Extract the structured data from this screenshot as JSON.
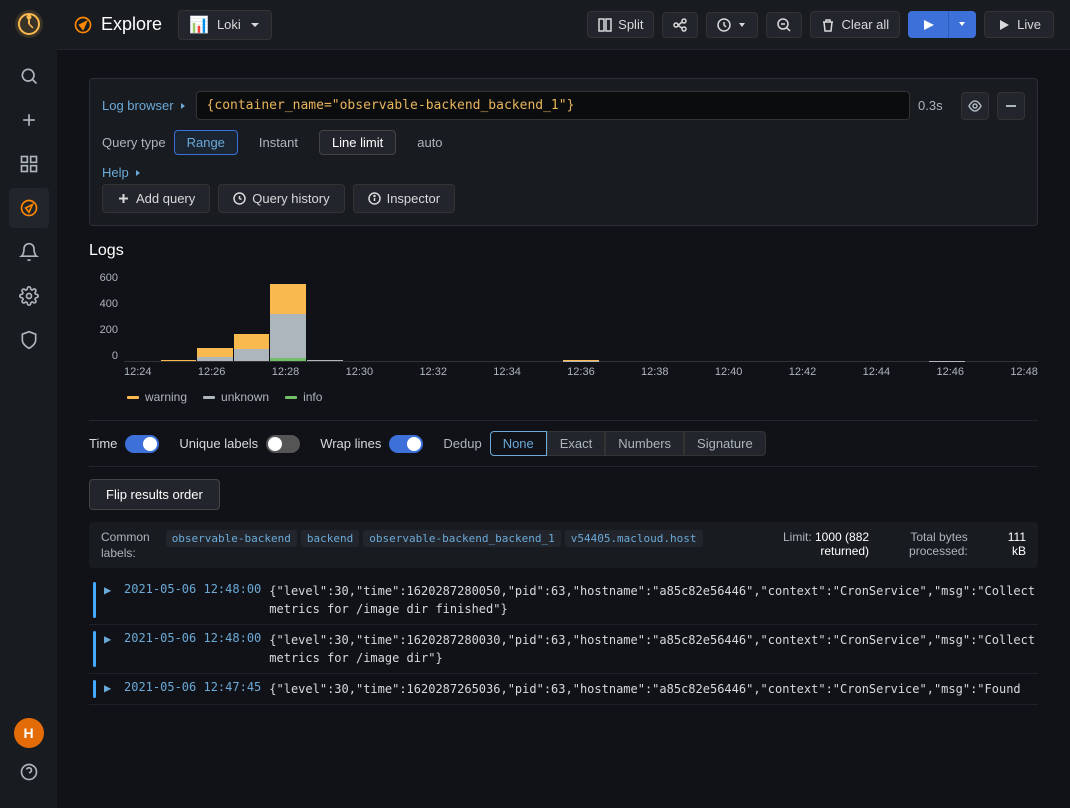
{
  "sidebar": {
    "logo_text": "G",
    "items": [
      {
        "id": "explore",
        "icon": "compass",
        "label": "Explore",
        "active": true
      },
      {
        "id": "search",
        "icon": "search",
        "label": "Search"
      },
      {
        "id": "add",
        "icon": "plus",
        "label": "Add"
      },
      {
        "id": "dashboards",
        "icon": "grid",
        "label": "Dashboards"
      },
      {
        "id": "explore-nav",
        "icon": "compass2",
        "label": "Explore"
      },
      {
        "id": "alerts",
        "icon": "bell",
        "label": "Alerts"
      },
      {
        "id": "settings",
        "icon": "gear",
        "label": "Settings"
      },
      {
        "id": "shield",
        "icon": "shield",
        "label": "Shield"
      }
    ],
    "bottom": [
      {
        "id": "avatar",
        "label": "H"
      },
      {
        "id": "help",
        "icon": "question",
        "label": "Help"
      }
    ]
  },
  "toolbar": {
    "explore_label": "Explore",
    "datasource_name": "Loki",
    "split_label": "Split",
    "clear_all_label": "Clear all",
    "live_label": "Live",
    "run_label": "Run"
  },
  "query": {
    "log_browser_label": "Log browser",
    "query_value": "{container_name=\"observable-backend_backend_1\"}",
    "query_time": "0.3s",
    "query_type_label": "Query type",
    "type_range": "Range",
    "type_instant": "Instant",
    "type_line_limit": "Line limit",
    "type_auto": "auto",
    "help_label": "Help"
  },
  "query_actions": {
    "add_query_label": "Add query",
    "query_history_label": "Query history",
    "inspector_label": "Inspector"
  },
  "logs": {
    "title": "Logs",
    "chart": {
      "y_labels": [
        "600",
        "400",
        "200",
        "0"
      ],
      "x_labels": [
        "12:24",
        "12:26",
        "12:28",
        "12:30",
        "12:32",
        "12:34",
        "12:36",
        "12:38",
        "12:40",
        "12:42",
        "12:44",
        "12:46",
        "12:48"
      ],
      "bars": [
        {
          "label": "12:24",
          "warning": 0,
          "unknown": 0,
          "info": 0
        },
        {
          "label": "12:25",
          "warning": 5,
          "unknown": 5,
          "info": 0
        },
        {
          "label": "12:26",
          "warning": 60,
          "unknown": 30,
          "info": 5
        },
        {
          "label": "12:27",
          "warning": 100,
          "unknown": 80,
          "info": 10
        },
        {
          "label": "12:28",
          "warning": 200,
          "unknown": 300,
          "info": 20
        },
        {
          "label": "12:29",
          "warning": 0,
          "unknown": 5,
          "info": 0
        },
        {
          "label": "12:30",
          "warning": 0,
          "unknown": 0,
          "info": 2
        },
        {
          "label": "12:31",
          "warning": 0,
          "unknown": 0,
          "info": 0
        },
        {
          "label": "12:32",
          "warning": 0,
          "unknown": 0,
          "info": 0
        },
        {
          "label": "12:33",
          "warning": 0,
          "unknown": 0,
          "info": 0
        },
        {
          "label": "12:34",
          "warning": 0,
          "unknown": 0,
          "info": 0
        },
        {
          "label": "12:35",
          "warning": 0,
          "unknown": 0,
          "info": 0
        },
        {
          "label": "12:36",
          "warning": 3,
          "unknown": 2,
          "info": 0
        },
        {
          "label": "12:37",
          "warning": 0,
          "unknown": 0,
          "info": 0
        },
        {
          "label": "12:38",
          "warning": 0,
          "unknown": 0,
          "info": 0
        },
        {
          "label": "12:39",
          "warning": 0,
          "unknown": 0,
          "info": 0
        },
        {
          "label": "12:40",
          "warning": 0,
          "unknown": 0,
          "info": 0
        },
        {
          "label": "12:41",
          "warning": 0,
          "unknown": 0,
          "info": 0
        },
        {
          "label": "12:42",
          "warning": 0,
          "unknown": 0,
          "info": 0
        },
        {
          "label": "12:43",
          "warning": 0,
          "unknown": 0,
          "info": 0
        },
        {
          "label": "12:44",
          "warning": 0,
          "unknown": 0,
          "info": 0
        },
        {
          "label": "12:45",
          "warning": 0,
          "unknown": 0,
          "info": 0
        },
        {
          "label": "12:46",
          "warning": 0,
          "unknown": 2,
          "info": 0
        },
        {
          "label": "12:47",
          "warning": 0,
          "unknown": 0,
          "info": 0
        },
        {
          "label": "12:48",
          "warning": 0,
          "unknown": 0,
          "info": 0
        }
      ],
      "max": 600,
      "legend": [
        {
          "label": "warning",
          "color": "#f9b94e"
        },
        {
          "label": "unknown",
          "color": "#adb5bd"
        },
        {
          "label": "info",
          "color": "#73bf69"
        }
      ]
    },
    "controls": {
      "time_label": "Time",
      "time_on": true,
      "unique_labels_label": "Unique labels",
      "unique_labels_on": false,
      "wrap_lines_label": "Wrap lines",
      "wrap_lines_on": true,
      "dedup_label": "Dedup",
      "dedup_options": [
        "None",
        "Exact",
        "Numbers",
        "Signature"
      ],
      "dedup_active": "None"
    },
    "flip_button_label": "Flip results order",
    "common_labels": {
      "label": "Common\nlabels:",
      "tags": [
        "observable-backend",
        "backend",
        "observable-backend_backend_1",
        "v54405.macloud.host"
      ],
      "limit_label": "Limit:",
      "limit_value": "1000 (882\nreturned)",
      "total_bytes_label": "Total bytes\nprocessed:",
      "total_bytes_value": "111\nkB"
    },
    "log_rows": [
      {
        "time": "2021-05-06 12:48:00",
        "msg": "{\"level\":30,\"time\":1620287280050,\"pid\":63,\"hostname\":\"a85c82e56446\",\"context\":\"CronService\",\"msg\":\"Collect metrics for /image dir finished\"}"
      },
      {
        "time": "2021-05-06 12:48:00",
        "msg": "{\"level\":30,\"time\":1620287280030,\"pid\":63,\"hostname\":\"a85c82e56446\",\"context\":\"CronService\",\"msg\":\"Collect metrics for /image dir\"}"
      },
      {
        "time": "2021-05-06 12:47:45",
        "msg": "{\"level\":30,\"time\":1620287265036,\"pid\":63,\"hostname\":\"a85c82e56446\",\"context\":\"CronService\",\"msg\":\"Found"
      }
    ]
  }
}
